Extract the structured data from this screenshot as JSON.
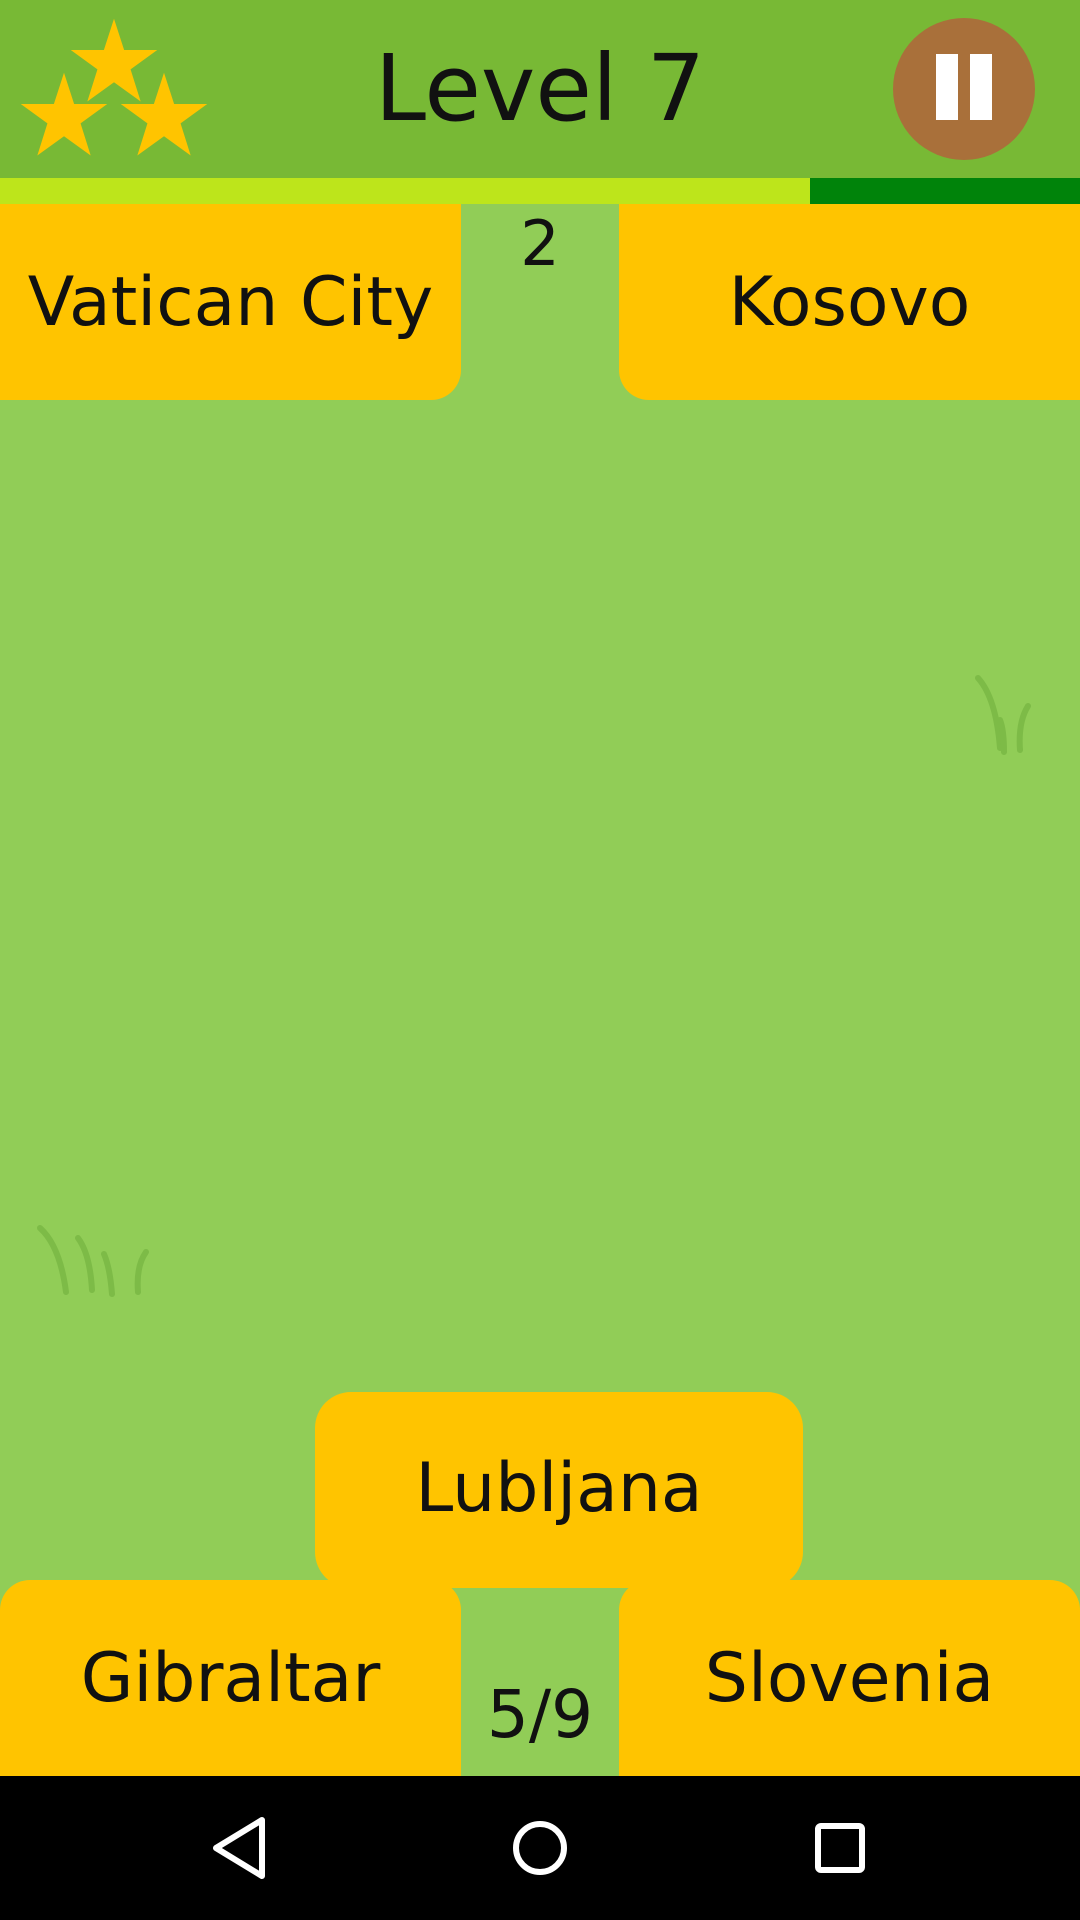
{
  "header": {
    "level_title": "Level 7",
    "stars_earned": 3,
    "star_color": "#ffc400",
    "pause_icon": "pause-icon",
    "pause_button_color": "#a9703a"
  },
  "timer": {
    "remaining_fraction": 0.75,
    "fill_color": "#bde51b",
    "track_color": "#00830a"
  },
  "cards": {
    "top_left": "Vatican City",
    "top_right": "Kosovo",
    "bottom_left": "Gibraltar",
    "bottom_right": "Slovenia",
    "current": "Lubljana"
  },
  "stats": {
    "matches": "2",
    "progress": "5/9"
  },
  "colors": {
    "background": "#91cd57",
    "header": "#78b935",
    "card": "#ffc400"
  },
  "navbar": {
    "back_icon": "back-triangle-icon",
    "home_icon": "home-circle-icon",
    "recent_icon": "recent-apps-square-icon"
  }
}
